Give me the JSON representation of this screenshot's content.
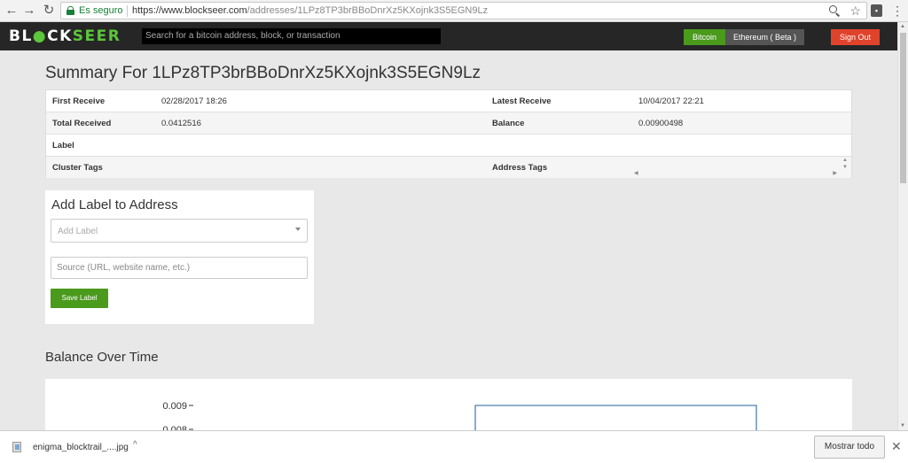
{
  "browser": {
    "secure_label": "Es seguro",
    "url_base": "https://www.blockseer.com",
    "url_path": "/addresses/1LPz8TP3brBBoDnrXz5KXojnk3S5EGN9Lz"
  },
  "nav": {
    "logo_a": "BL",
    "logo_b": "CK",
    "logo_c": "SEER",
    "search_placeholder": "Search for a bitcoin address, block, or transaction",
    "bitcoin": "Bitcoin",
    "ethereum": "Ethereum ( Beta )",
    "signout": "Sign Out"
  },
  "summary": {
    "title": "Summary For 1LPz8TP3brBBoDnrXz5KXojnk3S5EGN9Lz",
    "rows": [
      {
        "k1": "First Receive",
        "v1": "02/28/2017 18:26",
        "k2": "Latest Receive",
        "v2": "10/04/2017 22:21"
      },
      {
        "k1": "Total Received",
        "v1": "0.0412516",
        "k2": "Balance",
        "v2": "0.00900498"
      },
      {
        "k1": "Label",
        "v1": "",
        "k2": "",
        "v2": ""
      },
      {
        "k1": "Cluster Tags",
        "v1": "",
        "k2": "Address Tags",
        "v2": ""
      }
    ]
  },
  "label_form": {
    "title": "Add Label to Address",
    "select_placeholder": "Add Label",
    "source_placeholder": "Source (URL, website name, etc.)",
    "save": "Save Label"
  },
  "balance": {
    "title": "Balance Over Time"
  },
  "chart_data": {
    "type": "line",
    "title": "",
    "ylabel": "",
    "xlabel": "",
    "y_ticks": [
      "0.009",
      "0.008"
    ],
    "series": [
      {
        "values": [
          0.009,
          0.009
        ]
      }
    ],
    "line_color": "#4a7fb0"
  },
  "downloads": {
    "filename": "enigma_blocktrail_....jpg",
    "show_all": "Mostrar todo"
  }
}
